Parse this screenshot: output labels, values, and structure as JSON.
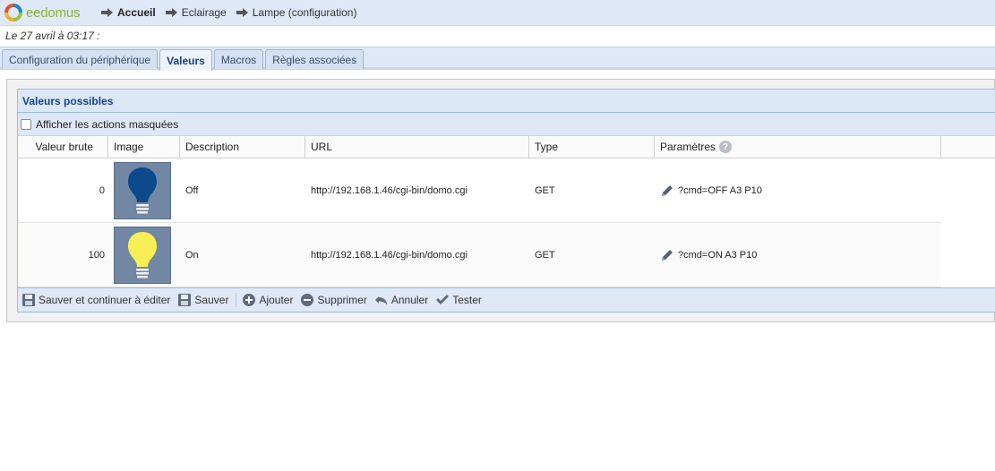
{
  "brand": {
    "name": "eedomus"
  },
  "breadcrumb": [
    {
      "label": "Accueil",
      "bold": true
    },
    {
      "label": "Eclairage",
      "bold": false
    },
    {
      "label": "Lampe (configuration)",
      "bold": false
    }
  ],
  "date_line": "Le 27 avril à 03:17 :",
  "tabs": [
    {
      "label": "Configuration du périphérique",
      "active": false
    },
    {
      "label": "Valeurs",
      "active": true
    },
    {
      "label": "Macros",
      "active": false
    },
    {
      "label": "Règles associées",
      "active": false
    }
  ],
  "panel": {
    "title": "Valeurs possibles",
    "show_hidden_label": "Afficher les actions masquées",
    "show_hidden_checked": false
  },
  "grid": {
    "columns": [
      "Valeur brute",
      "Image",
      "Description",
      "URL",
      "Type",
      "Paramètres"
    ],
    "rows": [
      {
        "raw_value": "0",
        "image": "bulb-off-icon",
        "description": "Off",
        "url": "http://192.168.1.46/cgi-bin/domo.cgi",
        "type": "GET",
        "params": "?cmd=OFF A3 P10"
      },
      {
        "raw_value": "100",
        "image": "bulb-on-icon",
        "description": "On",
        "url": "http://192.168.1.46/cgi-bin/domo.cgi",
        "type": "GET",
        "params": "?cmd=ON A3 P10"
      }
    ]
  },
  "toolbar": {
    "save_continue": "Sauver et continuer à éditer",
    "save": "Sauver",
    "add": "Ajouter",
    "delete": "Supprimer",
    "cancel": "Annuler",
    "test": "Tester"
  },
  "colors": {
    "header_bg": "#dfe8f6",
    "accent_blue": "#15428b",
    "bulb_off": "#0d4a8c",
    "bulb_on": "#f7ef55",
    "brand_green": "#8bb43a"
  }
}
